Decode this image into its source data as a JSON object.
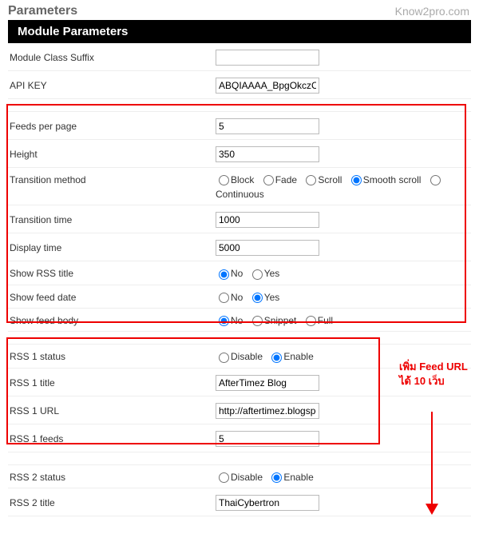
{
  "watermark": "Know2pro.com",
  "title": "Parameters",
  "moduleHeader": "Module Parameters",
  "rows": {
    "moduleClassSuffix": {
      "label": "Module Class Suffix",
      "value": ""
    },
    "apiKey": {
      "label": "API KEY",
      "value": "ABQIAAAA_BpgOkczCb("
    },
    "feedsPerPage": {
      "label": "Feeds per page",
      "value": "5"
    },
    "height": {
      "label": "Height",
      "value": "350"
    },
    "transitionMethod": {
      "label": "Transition method",
      "options": [
        "Block",
        "Fade",
        "Scroll",
        "Smooth scroll"
      ],
      "extraOption": "Continuous",
      "selected": "Smooth scroll"
    },
    "transitionTime": {
      "label": "Transition time",
      "value": "1000"
    },
    "displayTime": {
      "label": "Display time",
      "value": "5000"
    },
    "showRssTitle": {
      "label": "Show RSS title",
      "options": [
        "No",
        "Yes"
      ],
      "selected": "No"
    },
    "showFeedDate": {
      "label": "Show feed date",
      "options": [
        "No",
        "Yes"
      ],
      "selected": "Yes"
    },
    "showFeedBody": {
      "label": "Show feed body",
      "options": [
        "No",
        "Snippet",
        "Full"
      ],
      "selected": "No"
    },
    "rss1Status": {
      "label": "RSS 1 status",
      "options": [
        "Disable",
        "Enable"
      ],
      "selected": "Enable"
    },
    "rss1Title": {
      "label": "RSS 1 title",
      "value": "AfterTimez Blog"
    },
    "rss1Url": {
      "label": "RSS 1 URL",
      "value": "http://aftertimez.blogspo"
    },
    "rss1Feeds": {
      "label": "RSS 1 feeds",
      "value": "5"
    },
    "rss2Status": {
      "label": "RSS 2 status",
      "options": [
        "Disable",
        "Enable"
      ],
      "selected": "Enable"
    },
    "rss2Title": {
      "label": "RSS 2 title",
      "value": "ThaiCybertron"
    }
  },
  "annotation": "เพิ่ม Feed URL ได้ 10 เว็บ"
}
